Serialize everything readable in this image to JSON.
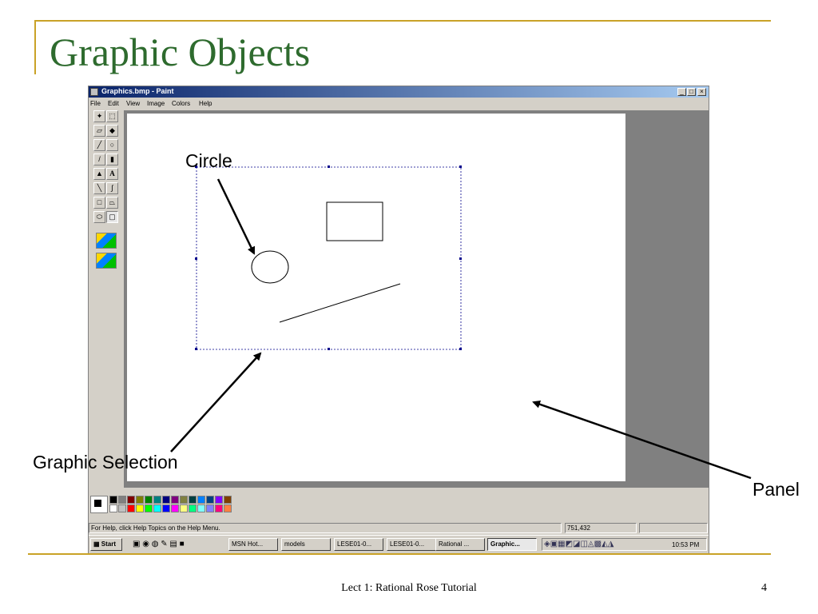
{
  "slide": {
    "title": "Graphic Objects",
    "footer": "Lect 1: Rational Rose Tutorial",
    "page_number": "4",
    "accent_color": "#c9a227",
    "title_color": "#2e6b2e"
  },
  "window": {
    "title": "Graphics.bmp - Paint",
    "controls": [
      "_",
      "□",
      "×"
    ],
    "menu": [
      "File",
      "Edit",
      "View",
      "Image",
      "Colors",
      "Help"
    ]
  },
  "toolbox": {
    "tools": [
      "free-select",
      "select",
      "eraser",
      "fill",
      "pick-color",
      "magnifier",
      "pencil",
      "brush",
      "airbrush",
      "text",
      "line",
      "curve",
      "rectangle",
      "polygon",
      "ellipse",
      "rounded-rectangle"
    ],
    "text_tool_label": "A"
  },
  "palette": {
    "colors": [
      "#000000",
      "#808080",
      "#800000",
      "#808000",
      "#008000",
      "#008080",
      "#000080",
      "#800080",
      "#808040",
      "#004040",
      "#0080ff",
      "#004080",
      "#8000ff",
      "#804000",
      "#ffffff",
      "#c0c0c0",
      "#ff0000",
      "#ffff00",
      "#00ff00",
      "#00ffff",
      "#0000ff",
      "#ff00ff",
      "#ffff80",
      "#00ff80",
      "#80ffff",
      "#8080ff",
      "#ff0080",
      "#ff8040"
    ]
  },
  "status": {
    "help_text": "For Help, click Help Topics on the Help Menu.",
    "coordinates": "751,432"
  },
  "taskbar": {
    "start": "Start",
    "tasks": [
      "MSN Hot...",
      "models",
      "LESE01-0...",
      "LESE01-0...",
      "Rational ...",
      "Graphic..."
    ],
    "clock": "10:53 PM"
  },
  "annotations": {
    "circle": "Circle",
    "graphic_selection": "Graphic Selection",
    "panel": "Panel"
  }
}
